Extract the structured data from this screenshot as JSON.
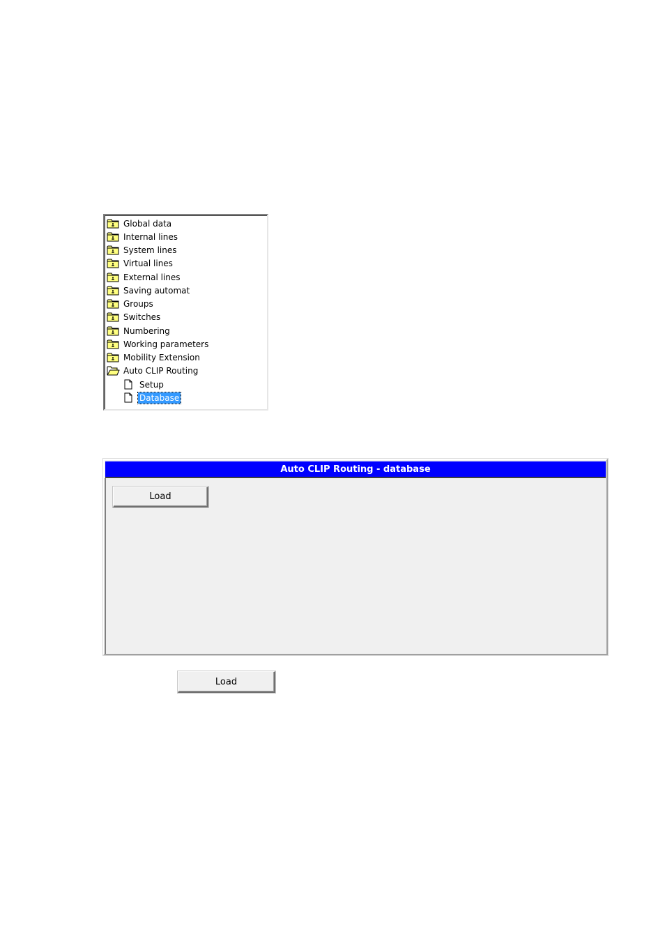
{
  "tree": {
    "items": [
      {
        "label": "Global data",
        "icon": "folder-closed-icon"
      },
      {
        "label": "Internal lines",
        "icon": "folder-closed-icon"
      },
      {
        "label": "System lines",
        "icon": "folder-closed-icon"
      },
      {
        "label": "Virtual lines",
        "icon": "folder-closed-icon"
      },
      {
        "label": "External lines",
        "icon": "folder-closed-icon"
      },
      {
        "label": "Saving automat",
        "icon": "folder-closed-icon"
      },
      {
        "label": "Groups",
        "icon": "folder-closed-icon"
      },
      {
        "label": "Switches",
        "icon": "folder-closed-icon"
      },
      {
        "label": "Numbering",
        "icon": "folder-closed-icon"
      },
      {
        "label": "Working parameters",
        "icon": "folder-closed-icon"
      },
      {
        "label": "Mobility Extension",
        "icon": "folder-closed-icon"
      },
      {
        "label": "Auto CLIP Routing",
        "icon": "folder-open-icon"
      },
      {
        "label": "Setup",
        "icon": "document-icon"
      },
      {
        "label": "Database",
        "icon": "document-icon",
        "selected": true
      }
    ]
  },
  "panel": {
    "title": "Auto CLIP Routing - database",
    "load_label": "Load",
    "title_color": "#0000ff"
  },
  "standalone": {
    "load_label": "Load"
  }
}
